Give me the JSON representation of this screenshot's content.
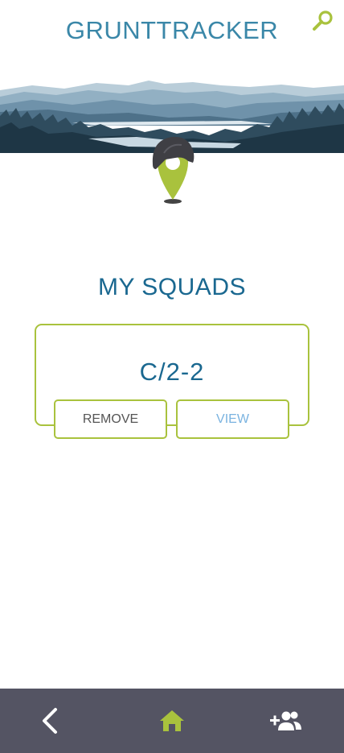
{
  "header": {
    "title": "GRUNTTRACKER",
    "search_icon": "search-icon"
  },
  "colors": {
    "accent": "#a9c23d",
    "title_blue": "#1a6890",
    "header_blue": "#3a87a8",
    "nav_bg": "#545463",
    "view_text": "#7ab3e0"
  },
  "main": {
    "section_title": "MY SQUADS",
    "squad": {
      "name": "C/2-2",
      "remove_label": "REMOVE",
      "view_label": "VIEW"
    }
  },
  "bottom_nav": {
    "items": [
      {
        "icon": "chevron-left-icon"
      },
      {
        "icon": "home-icon"
      },
      {
        "icon": "add-user-icon"
      }
    ]
  }
}
